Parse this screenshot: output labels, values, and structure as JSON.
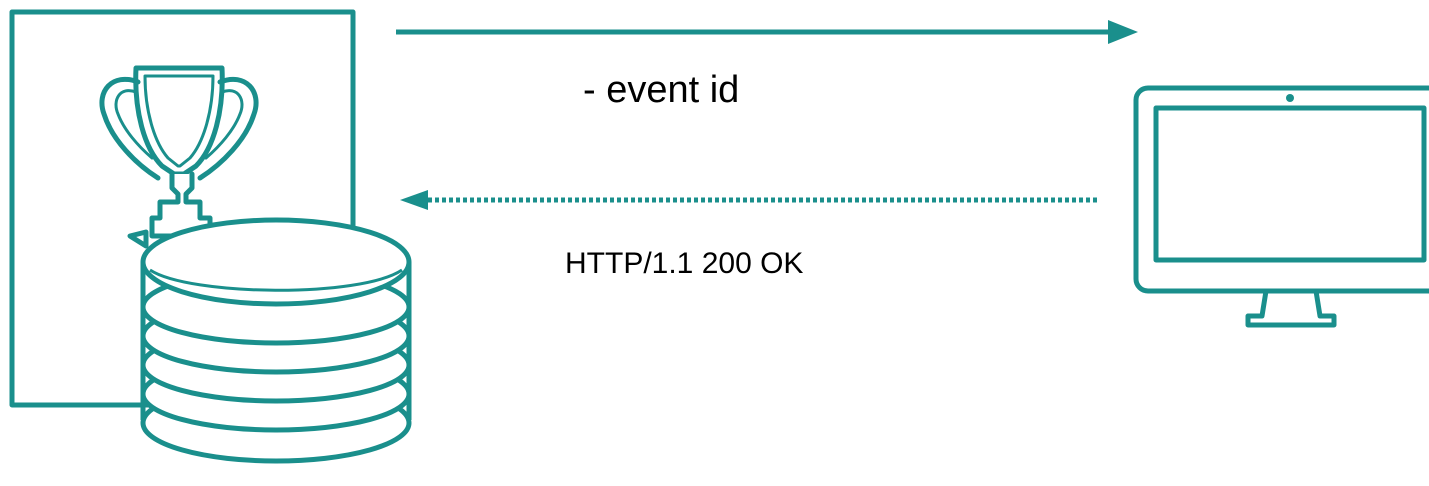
{
  "request": {
    "label": "- event id"
  },
  "response": {
    "label": "HTTP/1.1 200 OK"
  },
  "colors": {
    "stroke": "#1a8f8c",
    "fill": "#ffffff",
    "text": "#000000"
  },
  "icons": {
    "server": "trophy-icon",
    "database": "coin-stack-icon",
    "client": "monitor-icon"
  }
}
